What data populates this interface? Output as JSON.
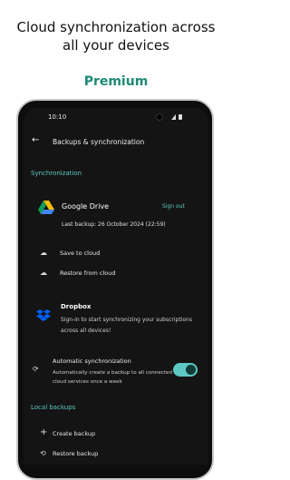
{
  "headline_line1": "Cloud synchronization across",
  "headline_line2": "all your devices",
  "badge": "Premium",
  "status": {
    "time": "10:10"
  },
  "appbar": {
    "title": "Backups & synchronization"
  },
  "sections": {
    "sync": "Synchronization",
    "local": "Local backups"
  },
  "google_drive": {
    "name": "Google Drive",
    "sign_out": "Sign out",
    "last_backup": "Last backup: 26 October 2024 (22:59)",
    "save": "Save to cloud",
    "restore": "Restore from cloud"
  },
  "dropbox": {
    "name": "Dropbox",
    "desc": "Sign-in to start synchronizing your subscriptions across all devices!"
  },
  "auto_sync": {
    "title": "Automatic synchronization",
    "desc": "Automatically create a backup to all connected cloud services once a week",
    "enabled": true
  },
  "local_backups": {
    "create": "Create backup",
    "restore": "Restore backup"
  },
  "colors": {
    "accent": "#5ec9c2",
    "badge": "#1f8a74",
    "screen": "#141414"
  }
}
